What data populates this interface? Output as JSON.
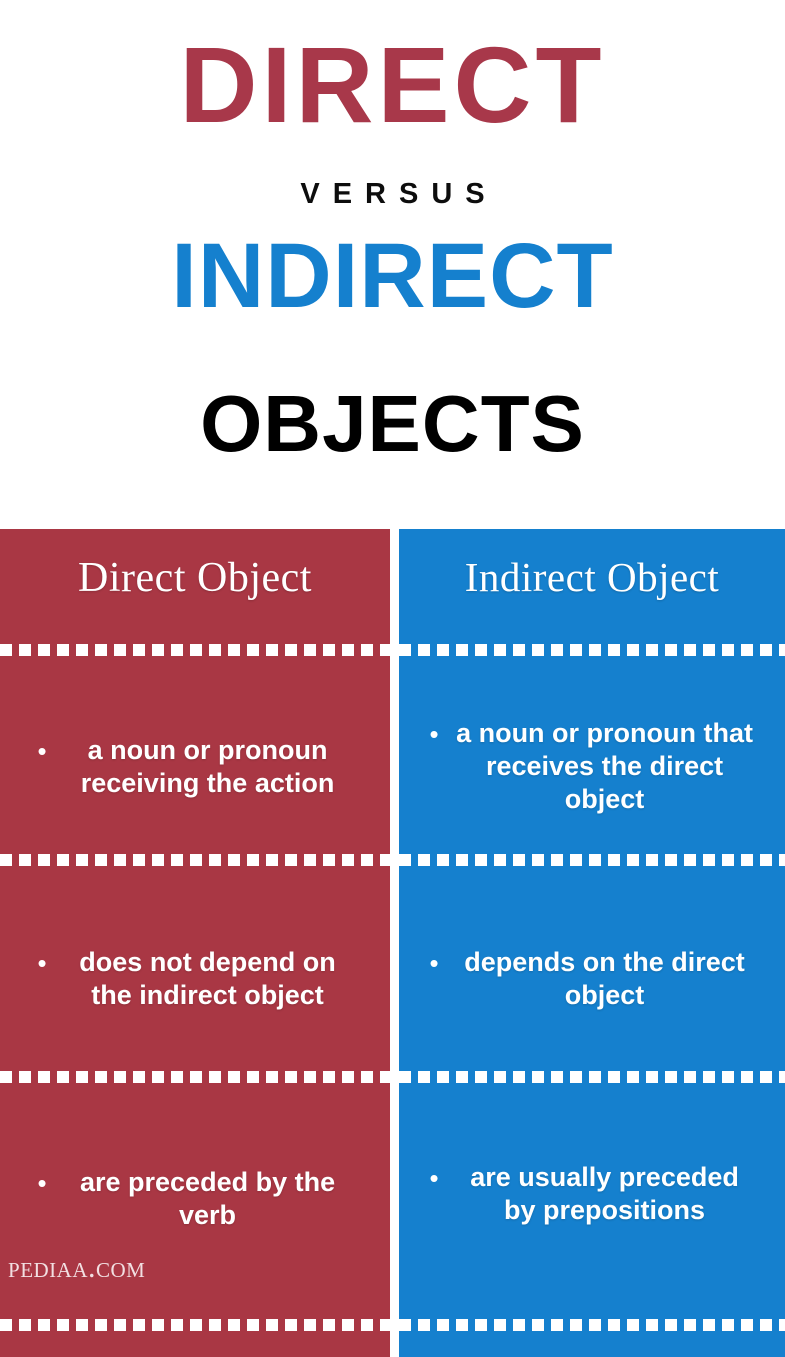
{
  "title": {
    "line1": "DIRECT",
    "line2": "VERSUS",
    "line3": "INDIRECT",
    "line4": "OBJECTS"
  },
  "colors": {
    "red": "#A93744",
    "blue": "#1580CE",
    "title_red": "#A8384A",
    "title_blue": "#1580CE",
    "title_black": "#000000",
    "white": "#FFFFFF",
    "watermark": "#F2DFE2"
  },
  "comparison": {
    "left": {
      "header": "Direct Object",
      "items": [
        "a noun or pronoun receiving the action",
        "does not depend on the indirect object",
        "are preceded by the verb"
      ]
    },
    "right": {
      "header": "Indirect Object",
      "items": [
        "a noun or pronoun that receives the direct object",
        "depends on the direct object",
        "are usually preceded by prepositions"
      ]
    }
  },
  "bullet_glyph": "•",
  "watermark": "Pediaa.com"
}
